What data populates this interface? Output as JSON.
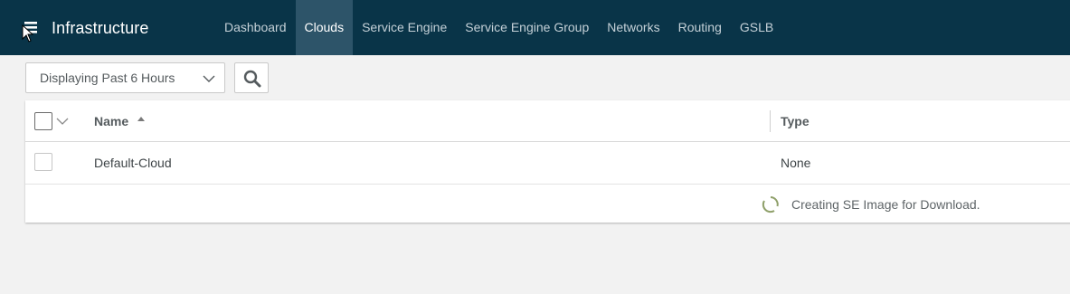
{
  "header": {
    "title": "Infrastructure",
    "nav": [
      {
        "label": "Dashboard",
        "active": false
      },
      {
        "label": "Clouds",
        "active": true
      },
      {
        "label": "Service Engine",
        "active": false
      },
      {
        "label": "Service Engine Group",
        "active": false
      },
      {
        "label": "Networks",
        "active": false
      },
      {
        "label": "Routing",
        "active": false
      },
      {
        "label": "GSLB",
        "active": false
      }
    ]
  },
  "toolbar": {
    "time_range": "Displaying Past 6 Hours",
    "search_icon": "search-icon"
  },
  "grid": {
    "columns": {
      "name": "Name",
      "type": "Type"
    },
    "sort": "ascending",
    "rows": [
      {
        "name": "Default-Cloud",
        "type": "None"
      }
    ],
    "status": "Creating SE Image for Download."
  },
  "colors": {
    "header_bg": "#093448",
    "active_tab": "#2d5469",
    "spinner": "#8fa06a"
  }
}
